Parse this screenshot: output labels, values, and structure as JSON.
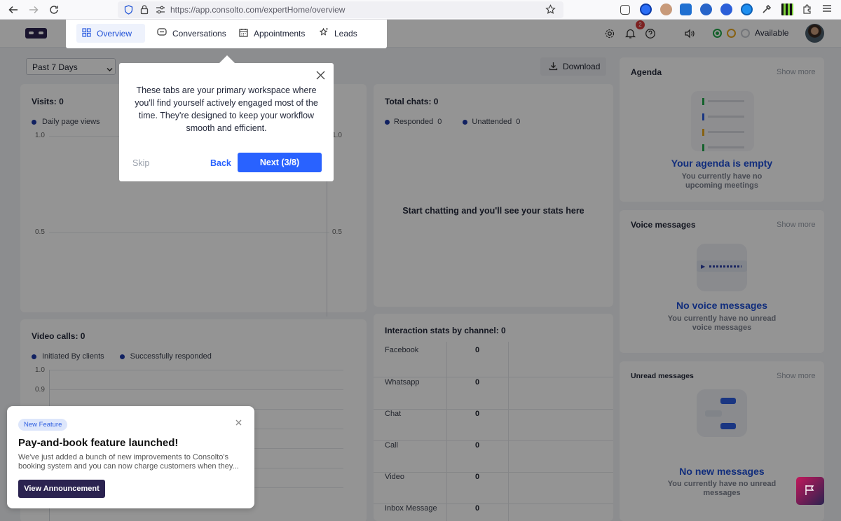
{
  "browser": {
    "url": "https://app.consolto.com/expertHome/overview"
  },
  "nav": {
    "tabs": [
      {
        "label": "Overview"
      },
      {
        "label": "Conversations"
      },
      {
        "label": "Appointments"
      },
      {
        "label": "Leads"
      }
    ],
    "notification_count": "2",
    "status": "Available"
  },
  "filters": {
    "range": "Past 7 Days",
    "download": "Download"
  },
  "visits": {
    "title": "Visits: 0",
    "legend": "Daily page views",
    "ticks": [
      "1.0",
      "0.5"
    ]
  },
  "chats": {
    "title": "Total chats: 0",
    "legend": [
      {
        "label": "Responded",
        "value": "0"
      },
      {
        "label": "Unattended",
        "value": "0"
      }
    ],
    "tick_top": "1.0",
    "tick_mid": "0.5",
    "empty": "Start chatting and you'll see your stats here"
  },
  "video": {
    "title": "Video calls: 0",
    "legend": [
      "Initiated By clients",
      "Successfully responded"
    ],
    "ticks": [
      "1.0",
      "0.9"
    ]
  },
  "interaction": {
    "title": "Interaction stats by channel: 0",
    "rows": [
      {
        "channel": "Facebook",
        "value": "0"
      },
      {
        "channel": "Whatsapp",
        "value": "0"
      },
      {
        "channel": "Chat",
        "value": "0"
      },
      {
        "channel": "Call",
        "value": "0"
      },
      {
        "channel": "Video",
        "value": "0"
      },
      {
        "channel": "Inbox Message",
        "value": "0"
      }
    ]
  },
  "agenda": {
    "title": "Agenda",
    "show_more": "Show more",
    "empty_title": "Your agenda is empty",
    "empty_sub": "You currently have no upcoming meetings"
  },
  "voice": {
    "title": "Voice messages",
    "show_more": "Show more",
    "empty_title": "No voice messages",
    "empty_sub": "You currently have no unread voice messages"
  },
  "unread": {
    "title": "Unread messages",
    "show_more": "Show more",
    "empty_title": "No new messages",
    "empty_sub": "You currently have no unread messages"
  },
  "tour": {
    "text": "These tabs are your primary workspace where you'll find yourself actively engaged most of the time. They're designed to keep your workflow smooth and efficient.",
    "skip": "Skip",
    "back": "Back",
    "next": "Next (3/8)"
  },
  "announcement": {
    "badge": "New Feature",
    "title": "Pay-and-book feature launched!",
    "body": "We've just added a bunch of new improvements to Consolto's booking system and you can now charge customers when they...",
    "button": "View Announcement"
  },
  "colors": {
    "accent": "#2962ff",
    "brand_dark": "#2b2350",
    "status_online": "#21a84a"
  }
}
